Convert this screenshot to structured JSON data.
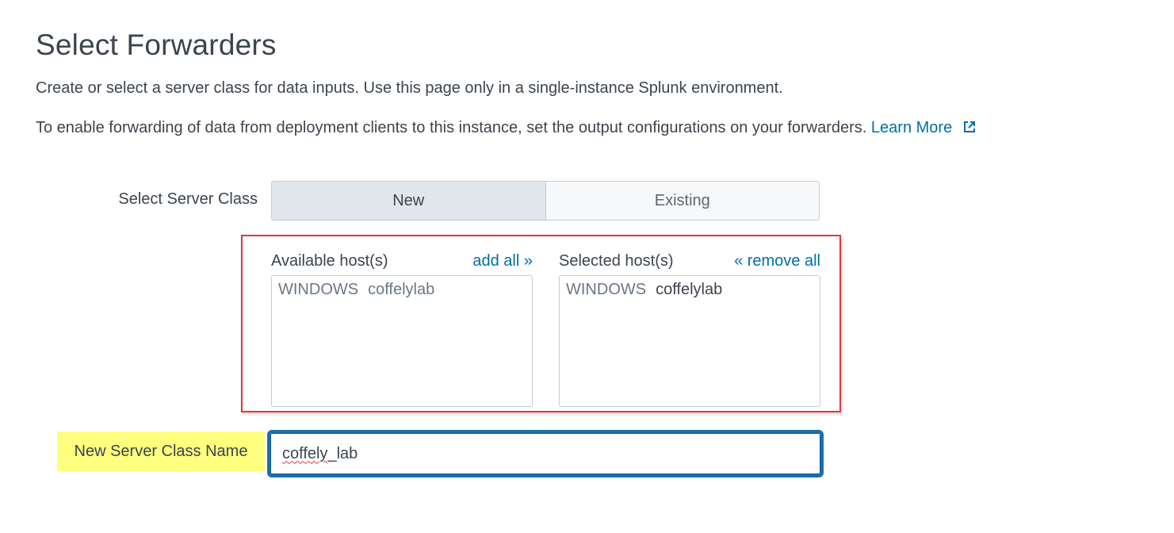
{
  "page": {
    "title": "Select Forwarders",
    "description_1": "Create or select a server class for data inputs. Use this page only in a single-instance Splunk environment.",
    "description_2": "To enable forwarding of data from deployment clients to this instance, set the output configurations on your forwarders.",
    "learn_more_label": "Learn More"
  },
  "server_class": {
    "label": "Select Server Class",
    "options": [
      "New",
      "Existing"
    ],
    "selected": "New"
  },
  "hosts": {
    "available_title": "Available host(s)",
    "add_all_label": "add all »",
    "selected_title": "Selected host(s)",
    "remove_all_label": "« remove all",
    "available": [
      {
        "os": "WINDOWS",
        "name": "coffelylab"
      }
    ],
    "selected": [
      {
        "os": "WINDOWS",
        "name": "coffelylab"
      }
    ]
  },
  "new_server_class": {
    "label": "New Server Class Name",
    "value_part_1": "coffely",
    "value_part_2": "_lab"
  },
  "colors": {
    "link": "#006eaa",
    "highlight_box": "#e0393e",
    "label_highlight": "#ffff7f",
    "focus_border": "#1a6fb0"
  }
}
